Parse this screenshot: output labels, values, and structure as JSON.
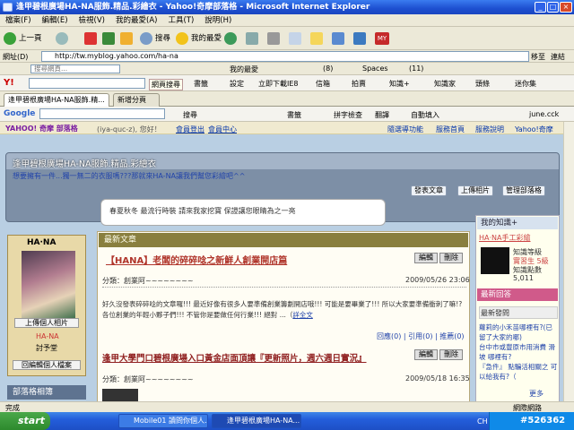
{
  "window": {
    "title": "逢甲碧根廣場HA-NA服飾.精品.彩繪衣 - Yahoo!奇摩部落格 - Microsoft Internet Explorer"
  },
  "menu": [
    "檔案(F)",
    "編輯(E)",
    "檢視(V)",
    "我的最愛(A)",
    "工具(T)",
    "說明(H)"
  ],
  "toolbar": {
    "back": "上一頁",
    "search": "搜尋",
    "favorites": "我的最愛"
  },
  "address": {
    "label": "網址(D)",
    "url": "http://tw.myblog.yahoo.com/ha-na",
    "go": "移至",
    "links": "連結"
  },
  "bar2": {
    "search_placeholder": "搜尋網頁...",
    "favorites": "我的最愛",
    "count1": "(8)",
    "spaces": "Spaces",
    "count2": "(11)"
  },
  "bar3": {
    "search_btn": "網頁搜尋",
    "bookmarks": "書籤",
    "settings": "設定",
    "ie8": "立即下載IE8",
    "mail": "信箱",
    "auction": "拍賣",
    "knowledge": "知識+",
    "know_house": "知識家",
    "news": "頭條",
    "messenger": "迷你集"
  },
  "tabs": [
    {
      "label": "逢甲碧根廣場HA-NA服飾.精..."
    },
    {
      "label": "新增分頁"
    }
  ],
  "bar4": {
    "brand": "Google",
    "search": "搜尋",
    "bookmarks": "書籤",
    "spell": "拼字檢查",
    "translate": "翻譯",
    "autofill": "自動填入",
    "user": "june.cck"
  },
  "blogbar": {
    "logo": "YAHOO! 奇摩 部落格",
    "greeting": "(iya-quc-z), 您好！",
    "links_left": [
      "會員登出",
      "會員中心"
    ],
    "links_right": [
      "隨選導功能",
      "服務首頁",
      "服務說明",
      "Yahoo!奇摩"
    ]
  },
  "header": {
    "title": "逢甲碧根廣場HA-NA服飾.精品.彩繪衣",
    "subtitle": "想要擁有一件...獨一無二的衣服嗎???那就來HA-NA讓我們幫您彩繪吧^^",
    "btn_post": "發表文章",
    "btn_upload": "上傳相片",
    "btn_manage": "管理部落格"
  },
  "bubble": {
    "text": "春夏秋冬 最流行時裝 請來我家挖寶 保證讓您眼睛為之一亮"
  },
  "left": {
    "shop": "HA·NA",
    "upload": "上傳個人相片",
    "name": "HA-NA",
    "id": "討予堂",
    "edit": "回編輯個人檔案",
    "section": "部落格相簿"
  },
  "main": {
    "section": "最新文章",
    "posts": [
      {
        "title": "【HANA】老闆的碎碎唸之新鮮人創業開店篇",
        "edit": "編輯",
        "del": "刪除",
        "category": "分類：創業阿~~~~~~~~",
        "date": "2009/05/26 23:06",
        "excerpt": "好久沒發表碎碎唸的文章囉!!! 最近好像有很多人要準備創業籌劃開店哦!!! 可能是要畢業了!!! 所以大家要準備衝刺了嘛!? 各位創業的年輕小夥子們!!! 不管你是要做任何行業!!! 絕對 ...（",
        "more": "詳全文",
        "stats": "回應(0) | 引用(0) | 推薦(0)"
      },
      {
        "title": "逢甲大學門口碧根廣場入口黃金店面頂讓『更新照片，週六週日實況』",
        "edit": "編輯",
        "del": "刪除",
        "category": "分類：創業阿~~~~~~~~",
        "date": "2009/05/18 16:35"
      }
    ]
  },
  "right": {
    "know_title": "我的知識+",
    "know_shop": "HA·NA手工彩繪",
    "know_items": [
      "知識等級",
      "實習生 5級",
      "知識點數"
    ],
    "points": "5,011",
    "recent_title": "最新回答",
    "recent_title2": "最新發問",
    "recent_items": [
      "蘿莉的小禾苗哪裡有?(已留了大家的哪)",
      "台中市或豐原市用消費 滑坡 哪裡有?",
      "『急件』 點騙活相關之 可以給我有?（",
      "更多"
    ]
  },
  "status": {
    "text": "完成",
    "zone": "網際網路"
  },
  "taskbar": {
    "start": "start",
    "tasks": [
      "Mobile01 讀問你個人...",
      "逢甲碧根廣場HA-NA..."
    ],
    "lang": "CH",
    "watermark": "#526362"
  },
  "colors": {
    "accent": "#245edb",
    "blog_header": "#7d8fa6",
    "section_bar": "#897f3f",
    "post_title": "#b0352b"
  }
}
